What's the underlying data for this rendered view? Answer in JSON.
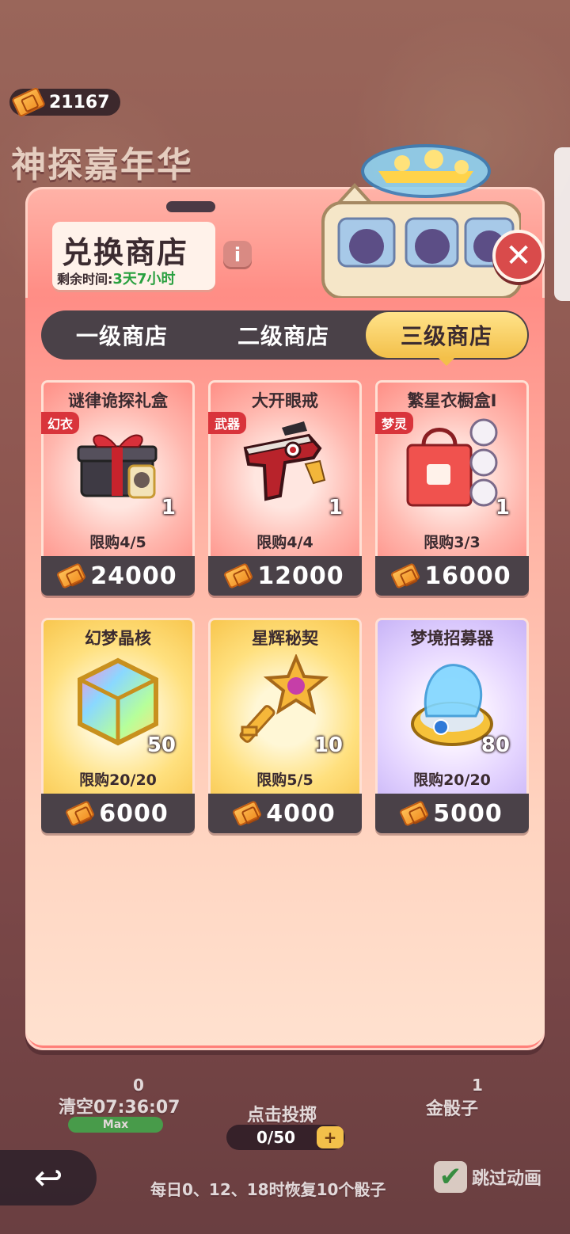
{
  "currency": {
    "amount": "21167",
    "icon": "ticket-icon"
  },
  "event": {
    "title": "神探嘉年华"
  },
  "shop": {
    "title": "兑换商店",
    "remaining_label": "剩余时间:",
    "remaining_time": "3天7小时",
    "info_label": "i",
    "close_label": "✕"
  },
  "tabs": [
    {
      "label": "一级商店",
      "active": false
    },
    {
      "label": "二级商店",
      "active": false
    },
    {
      "label": "三级商店",
      "active": true
    }
  ],
  "items": [
    {
      "name": "谜律诡探礼盒",
      "tag": "幻衣",
      "count": "1",
      "limit": "限购4/5",
      "price": "24000",
      "theme": "red",
      "icon": "gift-box-icon"
    },
    {
      "name": "大开眼戒",
      "tag": "武器",
      "count": "1",
      "limit": "限购4/4",
      "price": "12000",
      "theme": "red",
      "icon": "pistol-icon"
    },
    {
      "name": "繁星衣橱盒Ⅰ",
      "tag": "梦灵",
      "count": "1",
      "limit": "限购3/3",
      "price": "16000",
      "theme": "red",
      "icon": "shopping-bag-icon"
    },
    {
      "name": "幻梦晶核",
      "tag": "",
      "count": "50",
      "limit": "限购20/20",
      "price": "6000",
      "theme": "gold",
      "icon": "crystal-core-icon"
    },
    {
      "name": "星辉秘契",
      "tag": "",
      "count": "10",
      "limit": "限购5/5",
      "price": "4000",
      "theme": "gold",
      "icon": "star-key-icon"
    },
    {
      "name": "梦境招募器",
      "tag": "",
      "count": "80",
      "limit": "限购20/20",
      "price": "5000",
      "theme": "purple",
      "icon": "recruiter-device-icon"
    }
  ],
  "bottom": {
    "clear_count": "0",
    "clear_label": "清空07:36:07",
    "max_label": "Max",
    "roll_label": "点击投掷",
    "roll_count": "0/50",
    "plus_label": "+",
    "gold_dice_count": "1",
    "gold_dice_label": "金骰子",
    "hint": "每日0、12、18时恢复10个骰子",
    "skip_label": "跳过动画",
    "skip_checked": "✔",
    "back_icon": "↩"
  }
}
